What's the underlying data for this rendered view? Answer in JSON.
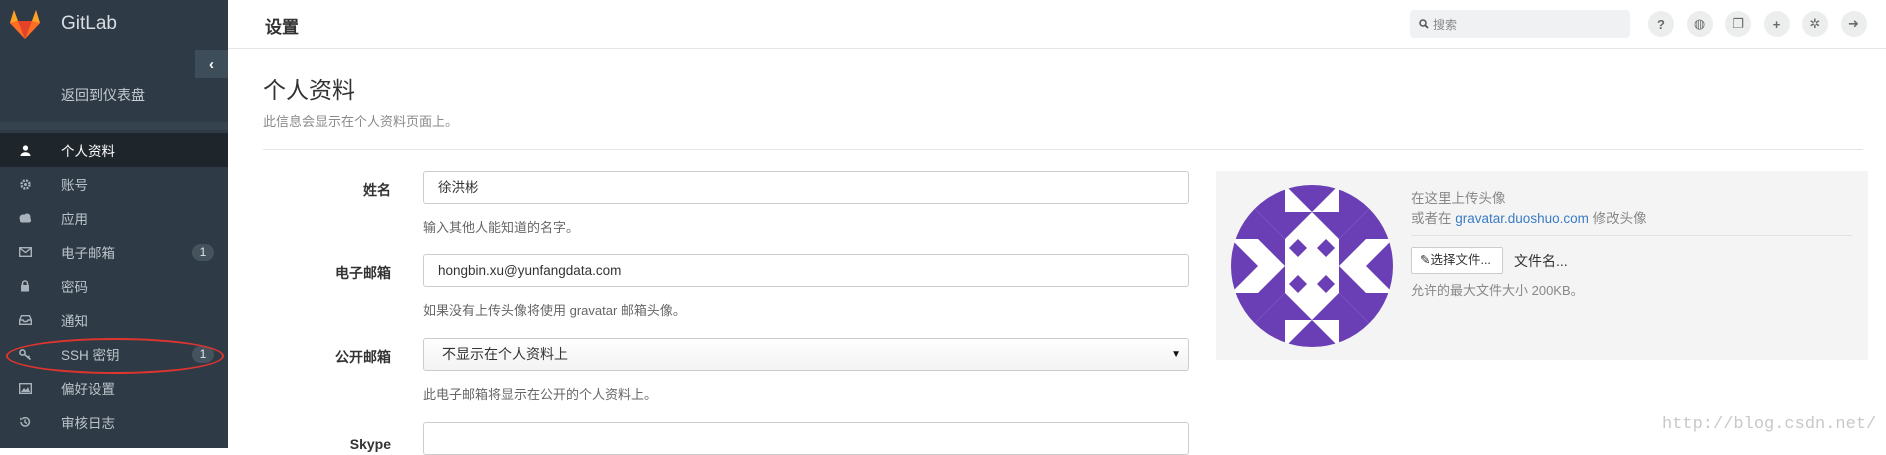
{
  "brand": {
    "name": "GitLab",
    "icon": "gitlab-fox-icon"
  },
  "sidebar": {
    "collapse_icon": "chevron-left-icon",
    "collapse_glyph": "‹",
    "back_label": "返回到仪表盘",
    "items": [
      {
        "label": "个人资料",
        "icon": "user-icon",
        "active": true
      },
      {
        "label": "账号",
        "icon": "gear-icon"
      },
      {
        "label": "应用",
        "icon": "cloud-icon"
      },
      {
        "label": "电子邮箱",
        "icon": "envelope-icon",
        "badge": "1"
      },
      {
        "label": "密码",
        "icon": "lock-icon"
      },
      {
        "label": "通知",
        "icon": "inbox-icon"
      },
      {
        "label": "SSH 密钥",
        "icon": "key-icon",
        "badge": "1"
      },
      {
        "label": "偏好设置",
        "icon": "image-icon"
      },
      {
        "label": "审核日志",
        "icon": "history-icon"
      }
    ]
  },
  "header": {
    "title": "设置",
    "search_placeholder": "搜索",
    "icons": [
      {
        "name": "help-icon",
        "glyph": "?"
      },
      {
        "name": "globe-icon",
        "glyph": "◍"
      },
      {
        "name": "copy-icon",
        "glyph": "❐"
      },
      {
        "name": "plus-icon",
        "glyph": "+"
      },
      {
        "name": "gear-icon",
        "glyph": "✲"
      },
      {
        "name": "sign-out-icon",
        "glyph": "➜"
      }
    ]
  },
  "main": {
    "title": "个人资料",
    "description": "此信息会显示在个人资料页面上。",
    "fields": {
      "name": {
        "label": "姓名",
        "value": "徐洪彬",
        "help": "输入其他人能知道的名字。"
      },
      "email": {
        "label": "电子邮箱",
        "value": "hongbin.xu@yunfangdata.com",
        "help": "如果没有上传头像将使用 gravatar 邮箱头像。"
      },
      "public_email": {
        "label": "公开邮箱",
        "value": "不显示在个人资料上",
        "help": "此电子邮箱将显示在公开的个人资料上。"
      },
      "skype": {
        "label": "Skype",
        "value": ""
      }
    }
  },
  "avatar": {
    "upload_text": "在这里上传头像",
    "or_prefix": "或者在",
    "link_text": "gravatar.duoshuo.com",
    "or_suffix": "修改头像",
    "choose_button": "✎选择文件...",
    "file_name": "文件名...",
    "size_help": "允许的最大文件大小 200KB。",
    "color": "#6a3fb5"
  },
  "watermark": "http://blog.csdn.net/"
}
